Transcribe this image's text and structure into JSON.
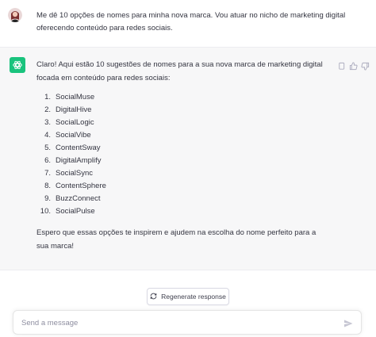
{
  "user_message": {
    "avatar": "user-avatar",
    "text": "Me dê 10 opções de nomes para minha nova marca. Vou atuar no nicho de marketing digital oferecendo conteúdo para redes sociais."
  },
  "assistant_message": {
    "logo": "chatgpt-logo-icon",
    "intro": "Claro! Aqui estão 10 sugestões de nomes para a sua nova marca de marketing digital focada em conteúdo para redes sociais:",
    "items": [
      {
        "num": "1.",
        "text": "SocialMuse"
      },
      {
        "num": "2.",
        "text": "DigitalHive"
      },
      {
        "num": "3.",
        "text": "SocialLogic"
      },
      {
        "num": "4.",
        "text": "SocialVibe"
      },
      {
        "num": "5.",
        "text": "ContentSway"
      },
      {
        "num": "6.",
        "text": "DigitalAmplify"
      },
      {
        "num": "7.",
        "text": "SocialSync"
      },
      {
        "num": "8.",
        "text": "ContentSphere"
      },
      {
        "num": "9.",
        "text": "BuzzConnect"
      },
      {
        "num": "10.",
        "text": "SocialPulse"
      }
    ],
    "outro": "Espero que essas opções te inspirem e ajudem na escolha do nome perfeito para a sua marca!",
    "action_icons": [
      "copy-icon",
      "thumbs-up-icon",
      "thumbs-down-icon"
    ]
  },
  "regenerate": {
    "icon": "refresh-icon",
    "label": "Regenerate response"
  },
  "composer": {
    "placeholder": "Send a message",
    "value": "",
    "send_icon": "send-icon"
  },
  "colors": {
    "accent": "#19c37d",
    "assistant_bg": "#f7f7f8",
    "text": "#343541"
  }
}
